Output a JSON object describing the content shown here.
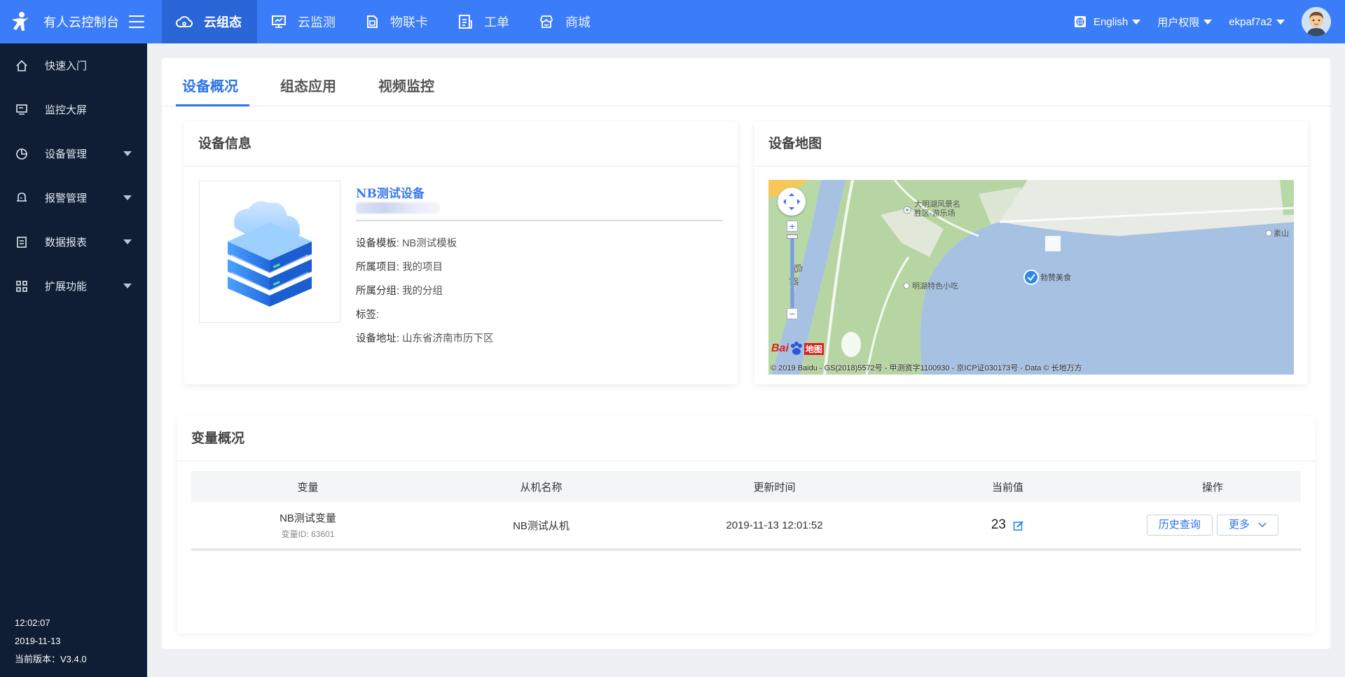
{
  "brand": {
    "name": "有人云控制台"
  },
  "nav": [
    {
      "label": "云组态",
      "icon": "cloud-icon"
    },
    {
      "label": "云监测",
      "icon": "monitor-icon"
    },
    {
      "label": "物联卡",
      "icon": "sim-card-icon"
    },
    {
      "label": "工单",
      "icon": "ticket-icon"
    },
    {
      "label": "商城",
      "icon": "store-icon"
    }
  ],
  "topright": {
    "language": "English",
    "permissions": "用户权限",
    "user": "ekpaf7a2"
  },
  "sidebar": {
    "items": [
      {
        "label": "快速入门",
        "icon": "home-icon"
      },
      {
        "label": "监控大屏",
        "icon": "screen-icon"
      },
      {
        "label": "设备管理",
        "icon": "pie-icon"
      },
      {
        "label": "报警管理",
        "icon": "bell-icon"
      },
      {
        "label": "数据报表",
        "icon": "report-icon"
      },
      {
        "label": "扩展功能",
        "icon": "grid-icon"
      }
    ],
    "time": "12:02:07",
    "date": "2019-11-13",
    "version": "当前版本：V3.4.0"
  },
  "tabs": [
    "设备概况",
    "组态应用",
    "视频监控"
  ],
  "device_info": {
    "title": "设备信息",
    "name": "NB测试设备",
    "props": [
      {
        "key": "设备模板:",
        "value": "NB测试模板"
      },
      {
        "key": "所属项目:",
        "value": "我的项目"
      },
      {
        "key": "所属分组:",
        "value": "我的分组"
      },
      {
        "key": "标签:",
        "value": ""
      },
      {
        "key": "设备地址:",
        "value": "山东省济南市历下区"
      }
    ]
  },
  "device_map": {
    "title": "设备地图",
    "labels": {
      "scenic": "大明湖风景名",
      "scenic2": "胜区-游乐场",
      "snack": "明湖特色小吃",
      "marker": "勃赞美食",
      "east": "素山",
      "road": "启",
      "road2": "路",
      "logo_bai": "Bai",
      "logo_map": "地图",
      "copyright": "© 2019 Baidu - GS(2018)5572号 - 甲测资字1100930 - 京ICP证030173号 - Data © 长地万方"
    }
  },
  "variables": {
    "title": "变量概况",
    "headers": [
      "变量",
      "从机名称",
      "更新时间",
      "当前值",
      "操作"
    ],
    "rows": [
      {
        "name": "NB测试变量",
        "id": "变量ID: 63601",
        "slave": "NB测试从机",
        "time": "2019-11-13 12:01:52",
        "value": "23",
        "history_btn": "历史查询",
        "more_btn": "更多"
      }
    ]
  }
}
